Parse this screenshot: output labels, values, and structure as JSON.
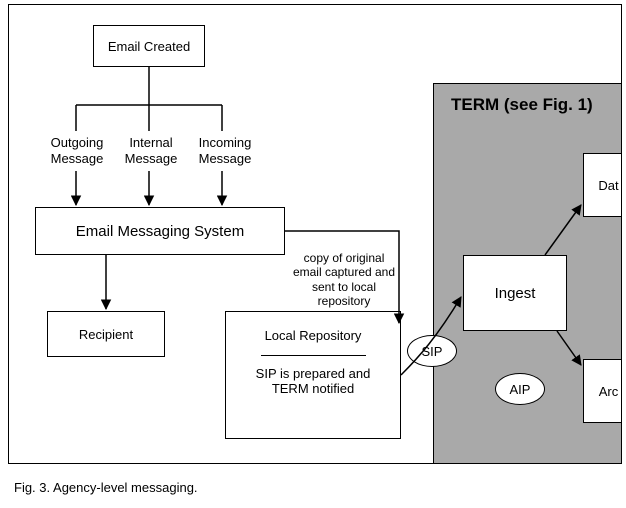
{
  "caption": "Fig. 3.  Agency-level messaging.",
  "box": {
    "email_created": "Email Created",
    "email_messaging_system": "Email Messaging System",
    "recipient": "Recipient",
    "local_repo_line1": "Local Repository",
    "local_repo_line2": "SIP is prepared and TERM notified",
    "ingest": "Ingest",
    "dat": "Dat",
    "arc": "Arc"
  },
  "label": {
    "outgoing_msg": "Outgoing Message",
    "internal_msg": "Internal Message",
    "incoming_msg": "Incoming Message",
    "copy_note": "copy of original email captured and sent to local repository"
  },
  "oval": {
    "sip": "SIP",
    "aip": "AIP"
  },
  "term_title": "TERM (see Fig. 1)"
}
